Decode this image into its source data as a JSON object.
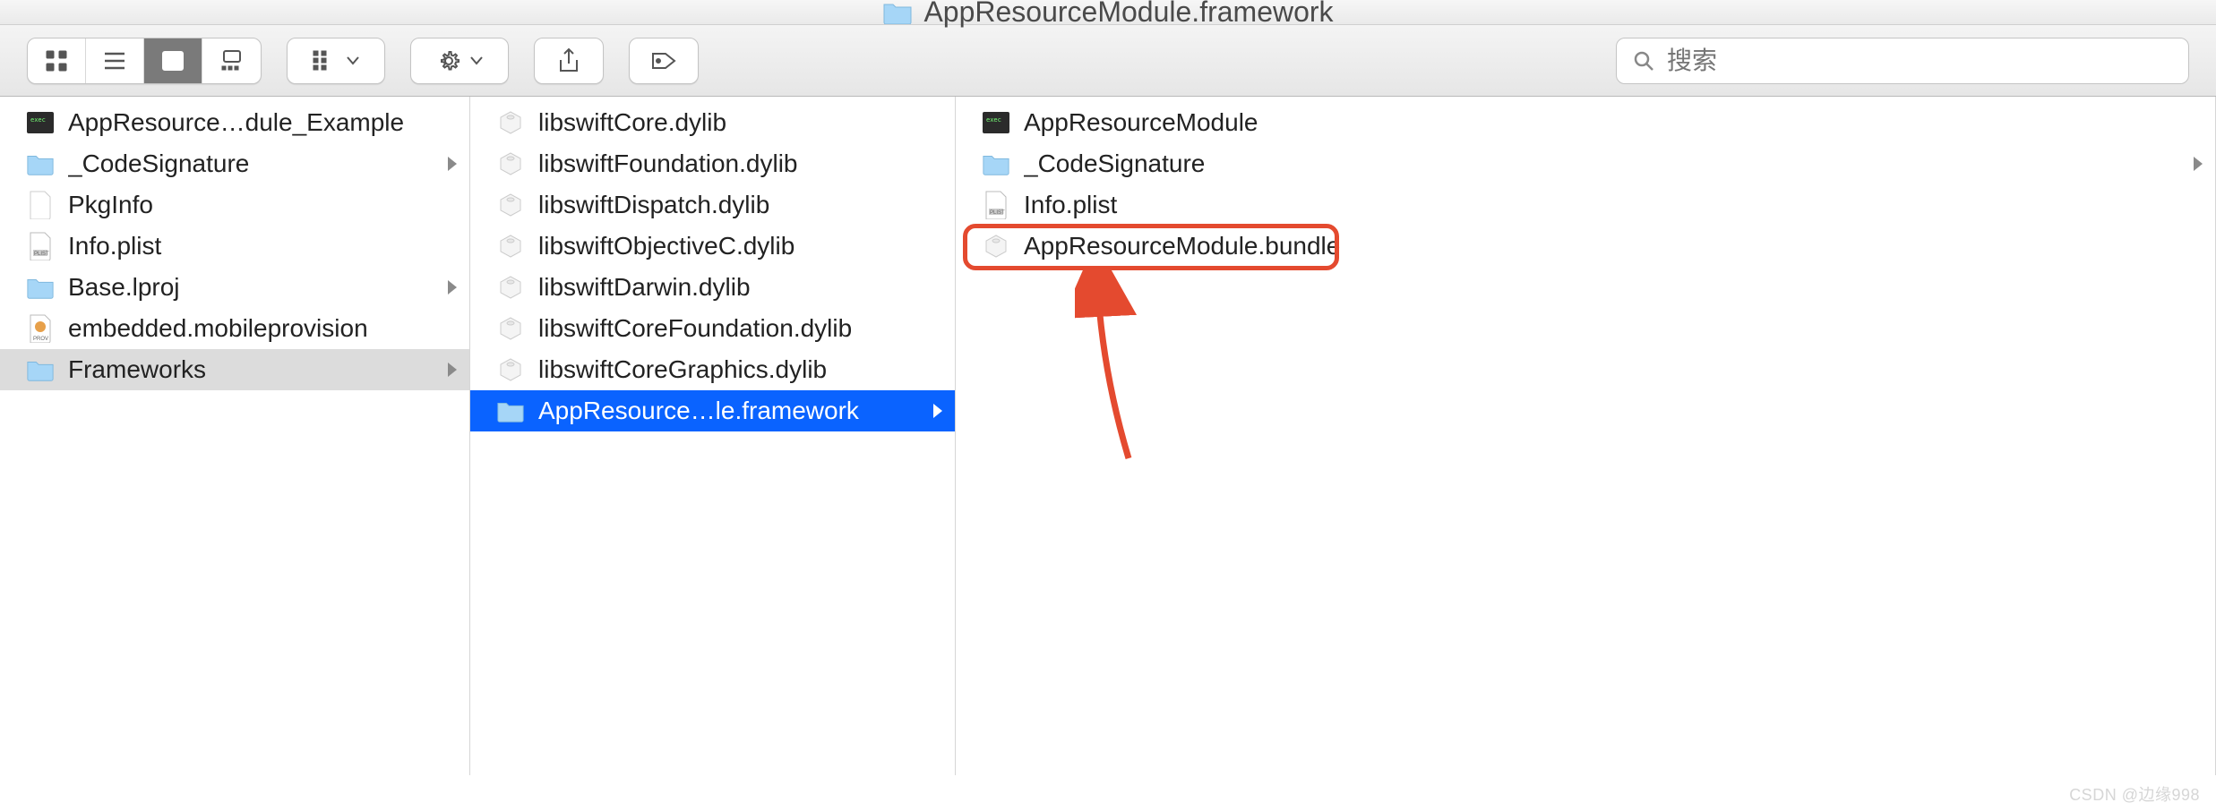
{
  "window": {
    "title": "AppResourceModule.framework"
  },
  "toolbar": {
    "search_placeholder": "搜索"
  },
  "columns": [
    {
      "items": [
        {
          "icon": "exec",
          "label": "AppResource…dule_Example",
          "arrow": false,
          "sel": ""
        },
        {
          "icon": "folder",
          "label": "_CodeSignature",
          "arrow": true,
          "sel": ""
        },
        {
          "icon": "blank",
          "label": "PkgInfo",
          "arrow": false,
          "sel": ""
        },
        {
          "icon": "plist",
          "label": "Info.plist",
          "arrow": false,
          "sel": ""
        },
        {
          "icon": "folder",
          "label": "Base.lproj",
          "arrow": true,
          "sel": ""
        },
        {
          "icon": "prov",
          "label": "embedded.mobileprovision",
          "arrow": false,
          "sel": ""
        },
        {
          "icon": "folder",
          "label": "Frameworks",
          "arrow": true,
          "sel": "gray"
        }
      ]
    },
    {
      "items": [
        {
          "icon": "lego",
          "label": "libswiftCore.dylib",
          "arrow": false,
          "sel": ""
        },
        {
          "icon": "lego",
          "label": "libswiftFoundation.dylib",
          "arrow": false,
          "sel": ""
        },
        {
          "icon": "lego",
          "label": "libswiftDispatch.dylib",
          "arrow": false,
          "sel": ""
        },
        {
          "icon": "lego",
          "label": "libswiftObjectiveC.dylib",
          "arrow": false,
          "sel": ""
        },
        {
          "icon": "lego",
          "label": "libswiftDarwin.dylib",
          "arrow": false,
          "sel": ""
        },
        {
          "icon": "lego",
          "label": "libswiftCoreFoundation.dylib",
          "arrow": false,
          "sel": ""
        },
        {
          "icon": "lego",
          "label": "libswiftCoreGraphics.dylib",
          "arrow": false,
          "sel": ""
        },
        {
          "icon": "folder",
          "label": "AppResource…le.framework",
          "arrow": true,
          "sel": "blue"
        }
      ]
    },
    {
      "items": [
        {
          "icon": "exec",
          "label": "AppResourceModule",
          "arrow": false,
          "sel": ""
        },
        {
          "icon": "folder",
          "label": "_CodeSignature",
          "arrow": true,
          "sel": ""
        },
        {
          "icon": "plist",
          "label": "Info.plist",
          "arrow": false,
          "sel": ""
        },
        {
          "icon": "lego",
          "label": "AppResourceModule.bundle",
          "arrow": false,
          "sel": "",
          "highlighted": true
        }
      ]
    }
  ],
  "watermark": "CSDN @边缘998"
}
